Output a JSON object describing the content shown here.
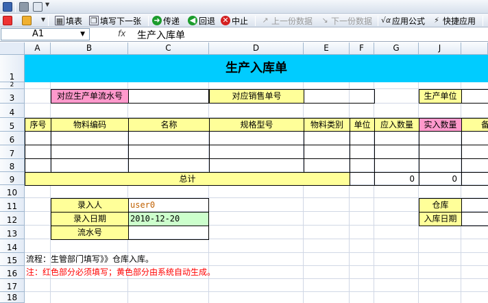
{
  "toolbar_row1": {
    "icons": [
      "save-icon",
      "print-icon",
      "print-preview-icon",
      "export-pdf-icon",
      "tools-icon"
    ]
  },
  "toolbar_row2": {
    "buttons": [
      {
        "name": "fill-form",
        "label": "填表",
        "icon": "table-icon",
        "enabled": true
      },
      {
        "name": "fill-next",
        "label": "填写下一张",
        "icon": "copy-icon",
        "enabled": true
      },
      {
        "name": "send",
        "label": "传递",
        "icon": "arrow-right-icon",
        "enabled": true
      },
      {
        "name": "return",
        "label": "回退",
        "icon": "arrow-left-icon",
        "enabled": true
      },
      {
        "name": "abort",
        "label": "中止",
        "icon": "stop-icon",
        "enabled": true
      },
      {
        "name": "prev-data",
        "label": "上一份数据",
        "icon": "prev-icon",
        "enabled": false
      },
      {
        "name": "next-data",
        "label": "下一份数据",
        "icon": "next-icon",
        "enabled": false
      },
      {
        "name": "apply-formula",
        "label": "应用公式",
        "icon": "formula-icon",
        "enabled": true
      },
      {
        "name": "quick-apply",
        "label": "快捷应用",
        "icon": "quick-formula-icon",
        "enabled": true
      }
    ]
  },
  "formula_bar": {
    "cell_ref": "A1",
    "fx_label": "fx",
    "value": "生产入库单"
  },
  "columns": [
    "A",
    "B",
    "C",
    "D",
    "E",
    "F",
    "G",
    "J"
  ],
  "rows": [
    "1",
    "2",
    "3",
    "4",
    "5",
    "6",
    "7",
    "8",
    "9",
    "10",
    "11",
    "12",
    "13",
    "14",
    "15",
    "16",
    "17",
    "18"
  ],
  "sheet": {
    "title": "生产入库单",
    "production_serial_label": "对应生产单流水号",
    "production_serial_value": "",
    "sales_order_label": "对应销售单号",
    "sales_order_value": "",
    "production_unit_label": "生产单位",
    "headers": [
      "序号",
      "物料编码",
      "名称",
      "规格型号",
      "物料类别",
      "单位",
      "应入数量",
      "实入数量",
      "备"
    ],
    "total_label": "总计",
    "total_expected": "0",
    "total_actual": "0",
    "entry_person_label": "录入人",
    "entry_person_value": "user0",
    "entry_date_label": "录入日期",
    "entry_date_value": "2010-12-20",
    "serial_label": "流水号",
    "serial_value": "",
    "warehouse_label": "仓库",
    "warehouse_value": "",
    "in_date_label": "入库日期",
    "in_date_value": "",
    "flow_note": "流程：生管部门填写》》仓库入库。",
    "note": "注：红色部分必须填写；黄色部分由系统自动生成。"
  },
  "colors": {
    "title_bg": "#00ccff",
    "required": "#ff99cc",
    "auto": "#ffff99",
    "entry_date_bg": "#ccffcc",
    "note_text": "#ff0000",
    "user_text": "#c06000"
  }
}
